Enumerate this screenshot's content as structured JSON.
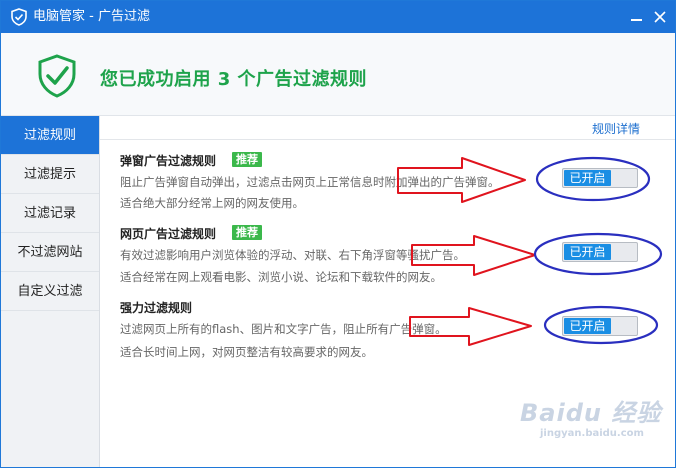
{
  "window": {
    "title": "电脑管家 - 广告过滤",
    "accent_color": "#1d73d8"
  },
  "header": {
    "icon": "shield-check-icon",
    "message": "您已成功启用 3 个广告过滤规则",
    "message_color": "#1ea34b"
  },
  "sidebar": {
    "items": [
      {
        "label": "过滤规则",
        "active": true
      },
      {
        "label": "过滤提示",
        "active": false
      },
      {
        "label": "过滤记录",
        "active": false
      },
      {
        "label": "不过滤网站",
        "active": false
      },
      {
        "label": "自定义过滤",
        "active": false
      }
    ]
  },
  "content": {
    "details_link": "规则详情",
    "rules": [
      {
        "title": "弹窗广告过滤规则",
        "badge": "推荐",
        "desc1": "阻止广告弹窗自动弹出，过滤点击网页上正常信息时附加弹出的广告弹窗。",
        "desc2": "适合绝大部分经常上网的网友使用。",
        "toggle": "已开启"
      },
      {
        "title": "网页广告过滤规则",
        "badge": "推荐",
        "desc1": "有效过滤影响用户浏览体验的浮动、对联、右下角浮窗等骚扰广告。",
        "desc2": "适合经常在网上观看电影、浏览小说、论坛和下载软件的网友。",
        "toggle": "已开启"
      },
      {
        "title": "强力过滤规则",
        "badge": "",
        "desc1": "过滤网页上所有的flash、图片和文字广告，阻止所有广告弹窗。",
        "desc2": "适合长时间上网，对网页整洁有较高要求的网友。",
        "toggle": "已开启"
      }
    ]
  },
  "annotations": {
    "arrow_color": "#e0141e",
    "circle_color": "#2a2fbf"
  },
  "watermark": {
    "main": "Baidu 经验",
    "sub": "jingyan.baidu.com"
  }
}
